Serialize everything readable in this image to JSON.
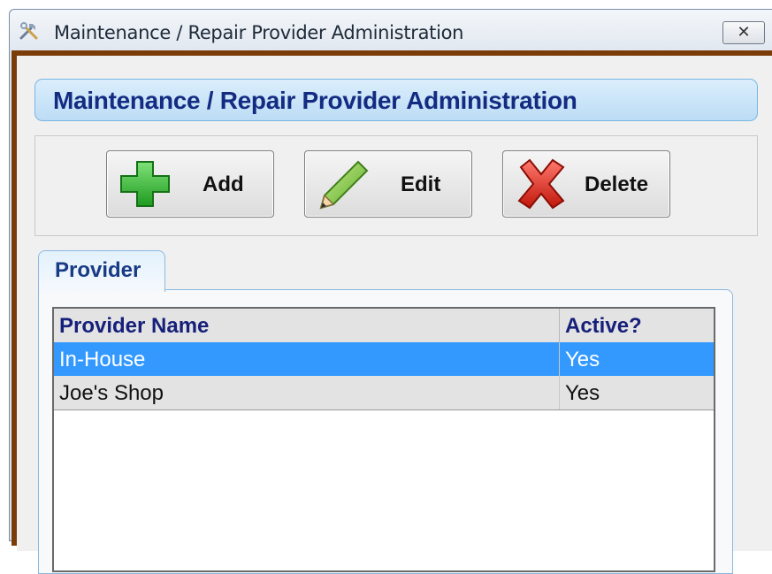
{
  "window": {
    "title": "Maintenance / Repair Provider Administration",
    "close_glyph": "✕"
  },
  "header": {
    "title": "Maintenance / Repair Provider Administration"
  },
  "toolbar": {
    "add_label": "Add",
    "edit_label": "Edit",
    "delete_label": "Delete"
  },
  "tabs": [
    {
      "label": "Provider"
    }
  ],
  "grid": {
    "columns": [
      "Provider Name",
      "Active?"
    ],
    "rows": [
      {
        "name": "In-House",
        "active": "Yes",
        "selected": true
      },
      {
        "name": "Joe's Shop",
        "active": "Yes",
        "selected": false
      }
    ]
  },
  "colors": {
    "selection": "#3399ff",
    "header_text": "#132c82",
    "frame": "#7a3d0a"
  },
  "icons": {
    "app": "tools-icon",
    "add": "plus-icon",
    "edit": "pencil-icon",
    "delete": "x-icon"
  }
}
